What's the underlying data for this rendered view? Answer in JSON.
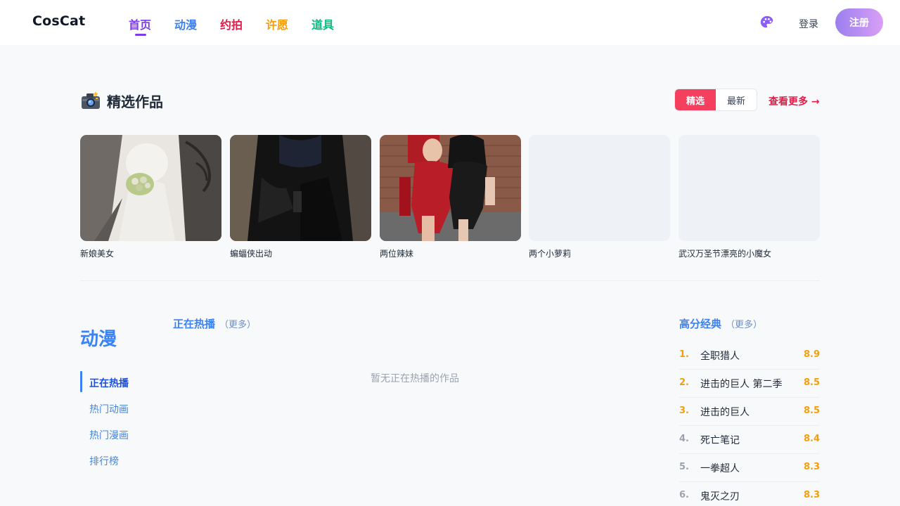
{
  "header": {
    "logo": "CosCat",
    "nav": [
      {
        "label": "首页",
        "color": "#7c3aed",
        "active": true
      },
      {
        "label": "动漫",
        "color": "#3b82f6",
        "active": false
      },
      {
        "label": "约拍",
        "color": "#e11d48",
        "active": false
      },
      {
        "label": "许愿",
        "color": "#f59e0b",
        "active": false
      },
      {
        "label": "道具",
        "color": "#10b981",
        "active": false
      }
    ],
    "theme_icon": "palette-icon",
    "login_label": "登录",
    "register_label": "注册"
  },
  "featured": {
    "title": "精选作品",
    "title_icon": "camera-icon",
    "toggle": [
      "精选",
      "最新"
    ],
    "view_more": "查看更多 →",
    "cards": [
      {
        "caption": "新娘美女"
      },
      {
        "caption": "蝙蝠侠出动"
      },
      {
        "caption": "两位辣妹"
      },
      {
        "caption": "两个小萝莉"
      },
      {
        "caption": "武汉万圣节漂亮的小魔女"
      }
    ]
  },
  "anime": {
    "heading": "动漫",
    "menu": [
      "正在热播",
      "热门动画",
      "热门漫画",
      "排行榜"
    ],
    "now_playing": {
      "title": "正在热播",
      "more": "（更多）",
      "empty": "暂无正在热播的作品"
    },
    "classics": {
      "title": "高分经典",
      "more": "（更多）",
      "items": [
        {
          "rank": "1.",
          "title": "全职猎人",
          "score": "8.9"
        },
        {
          "rank": "2.",
          "title": "进击的巨人 第二季",
          "score": "8.5"
        },
        {
          "rank": "3.",
          "title": "进击的巨人",
          "score": "8.5"
        },
        {
          "rank": "4.",
          "title": "死亡笔记",
          "score": "8.4"
        },
        {
          "rank": "5.",
          "title": "一拳超人",
          "score": "8.3"
        },
        {
          "rank": "6.",
          "title": "鬼灭之刃",
          "score": "8.3"
        }
      ]
    }
  },
  "colors": {
    "accent_top3": "#f59e0b",
    "rank_other": "#9ca3af",
    "anime_blue": "#3b82f6"
  }
}
